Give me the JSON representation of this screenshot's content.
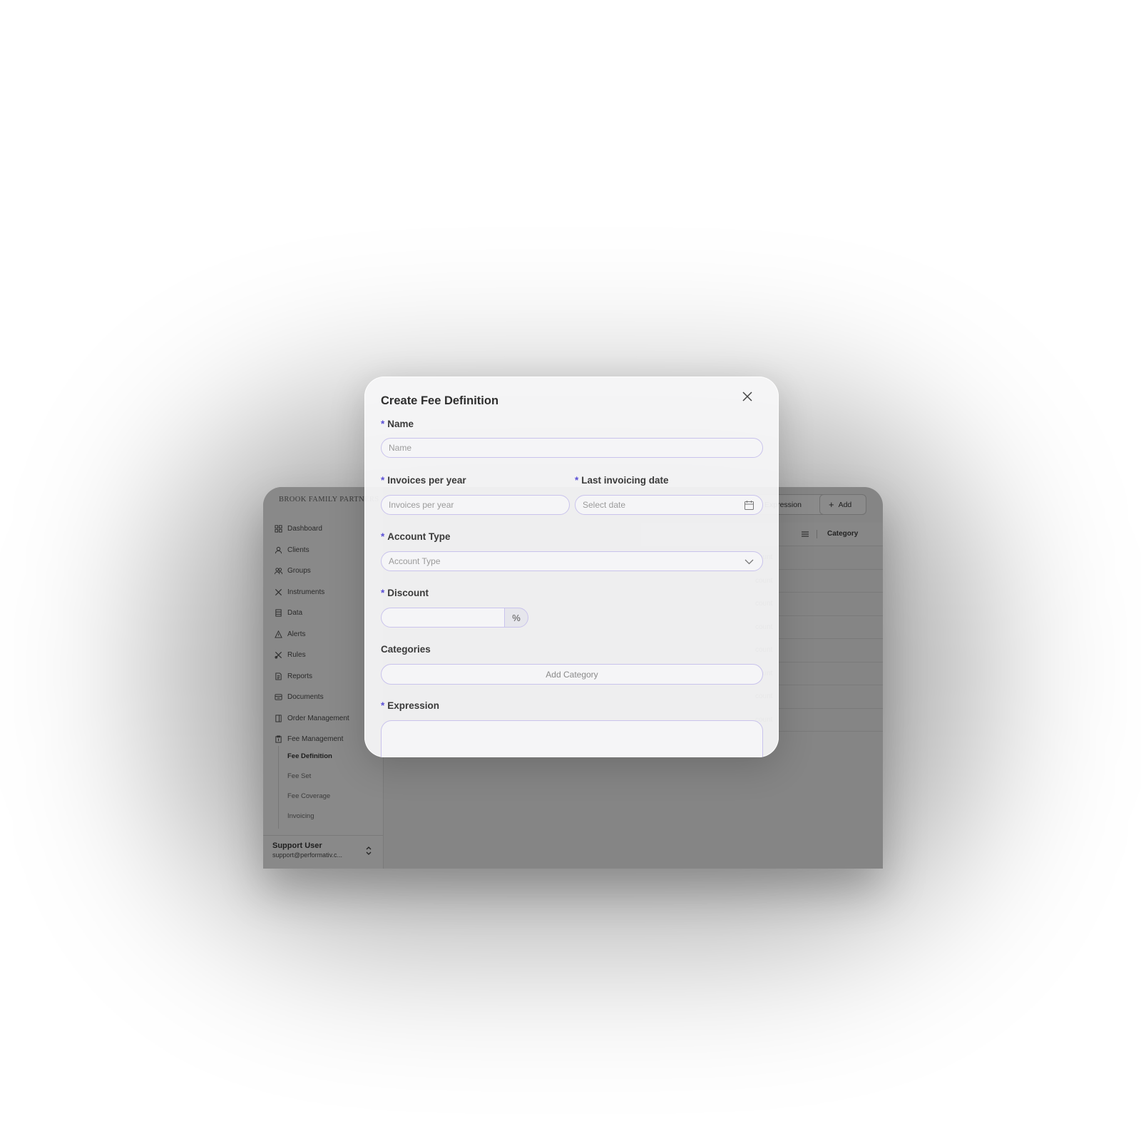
{
  "app": {
    "brand": "BROOK FAMILY PARTNERS",
    "nav": [
      {
        "label": "Dashboard",
        "icon": "dashboard-icon"
      },
      {
        "label": "Clients",
        "icon": "user-icon"
      },
      {
        "label": "Groups",
        "icon": "users-icon"
      },
      {
        "label": "Instruments",
        "icon": "tools-icon"
      },
      {
        "label": "Data",
        "icon": "database-icon"
      },
      {
        "label": "Alerts",
        "icon": "warning-icon"
      },
      {
        "label": "Rules",
        "icon": "rules-icon"
      },
      {
        "label": "Reports",
        "icon": "report-icon"
      },
      {
        "label": "Documents",
        "icon": "documents-icon"
      },
      {
        "label": "Order Management",
        "icon": "order-icon"
      },
      {
        "label": "Fee Management",
        "icon": "fee-icon"
      }
    ],
    "subnav": [
      {
        "label": "Fee Definition",
        "active": true
      },
      {
        "label": "Fee Set",
        "active": false
      },
      {
        "label": "Fee Coverage",
        "active": false
      },
      {
        "label": "Invoicing",
        "active": false
      }
    ],
    "user": {
      "name": "Support User",
      "email": "support@performativ.c..."
    },
    "toolbar": {
      "expression_label": "Expression",
      "add_label": "Add"
    },
    "table": {
      "header_category": "Category",
      "rows": [
        "count",
        "count",
        "count",
        "count",
        "count",
        "count",
        "count",
        "count"
      ]
    }
  },
  "modal": {
    "title": "Create Fee Definition",
    "required_mark": "*",
    "name": {
      "label": "Name",
      "placeholder": "Name"
    },
    "invoices_per_year": {
      "label": "Invoices per year",
      "placeholder": "Invoices per year"
    },
    "last_invoicing_date": {
      "label": "Last invoicing date",
      "placeholder": "Select date"
    },
    "account_type": {
      "label": "Account Type",
      "placeholder": "Account Type"
    },
    "discount": {
      "label": "Discount",
      "unit": "%"
    },
    "categories": {
      "label": "Categories",
      "add_label": "Add Category"
    },
    "expression": {
      "label": "Expression"
    }
  },
  "colors": {
    "accent": "#5b50d6",
    "input_border": "#c9c3ec"
  }
}
